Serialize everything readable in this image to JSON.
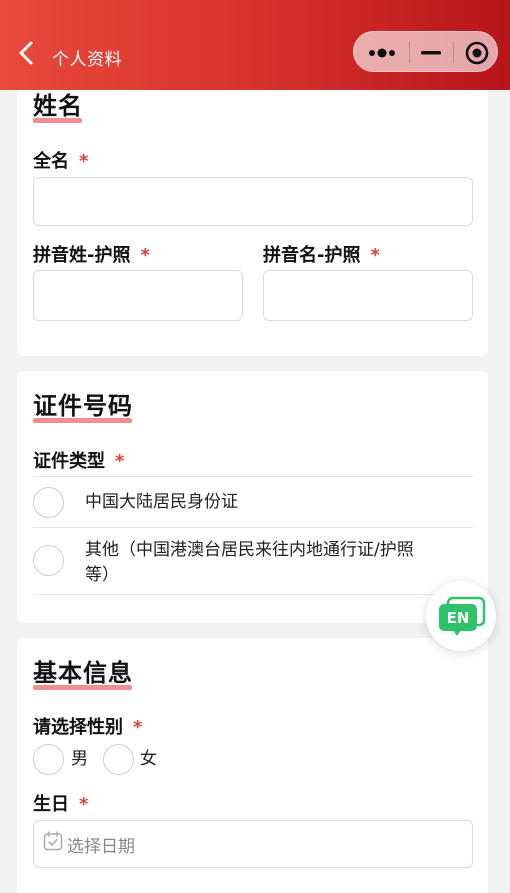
{
  "header": {
    "title": "个人资料"
  },
  "sections": {
    "name": {
      "title": "姓名",
      "full_name_label": "全名",
      "surname_label": "拼音姓-护照",
      "given_label": "拼音名-护照"
    },
    "id": {
      "title": "证件号码",
      "type_label": "证件类型",
      "options": [
        "中国大陆居民身份证",
        "其他（中国港澳台居民来往内地通行证/护照",
        "等）"
      ]
    },
    "basic": {
      "title": "基本信息",
      "gender_label": "请选择性别",
      "male": "男",
      "female": "女",
      "birthday_label": "生日",
      "date_placeholder": "选择日期"
    }
  },
  "required_mark": "*",
  "lang_button": "EN",
  "colors": {
    "header_start": "#e84a3c",
    "header_end": "#b8151c",
    "required": "#e0413b",
    "title_underline": "#ef8f90",
    "lang_icon": "#2fc26b"
  },
  "icons": {
    "back": "chevron-left-icon",
    "more": "more-dots-icon",
    "minimize": "minimize-icon",
    "close": "close-target-icon",
    "calendar": "calendar-icon",
    "language": "chat-bubble-en-icon"
  }
}
